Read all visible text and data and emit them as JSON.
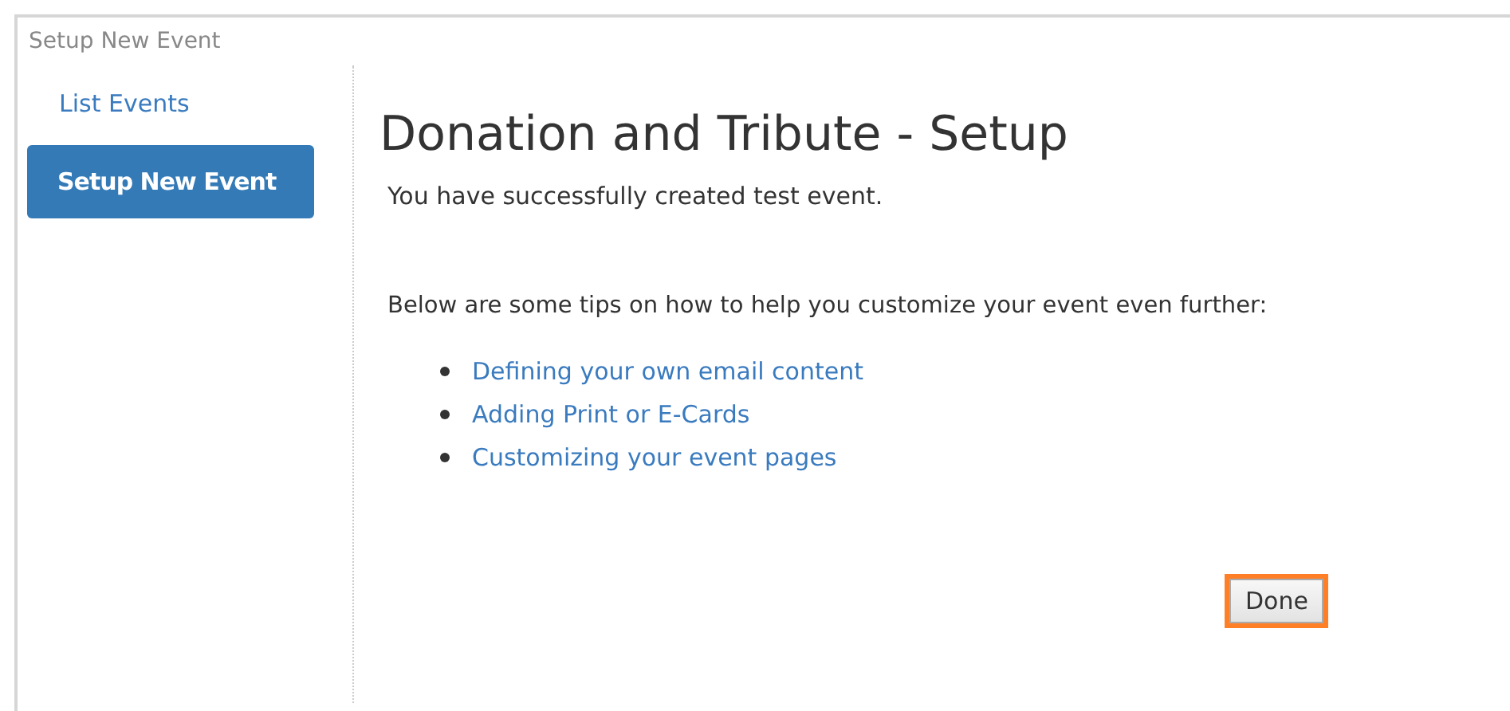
{
  "panel": {
    "title": "Setup New Event"
  },
  "sidebar": {
    "items": [
      {
        "label": "List Events",
        "selected": false
      },
      {
        "label": "Setup New Event",
        "selected": true
      }
    ]
  },
  "content": {
    "heading": "Donation and Tribute - Setup",
    "message": "You have successfully created test event.",
    "tips_intro": "Below are some tips on how to help you customize your event even further:",
    "tips": [
      "Defining your own email content",
      "Adding Print or E-Cards",
      "Customizing your event pages"
    ],
    "done_button": {
      "label": "Done",
      "highlighted": true
    }
  }
}
